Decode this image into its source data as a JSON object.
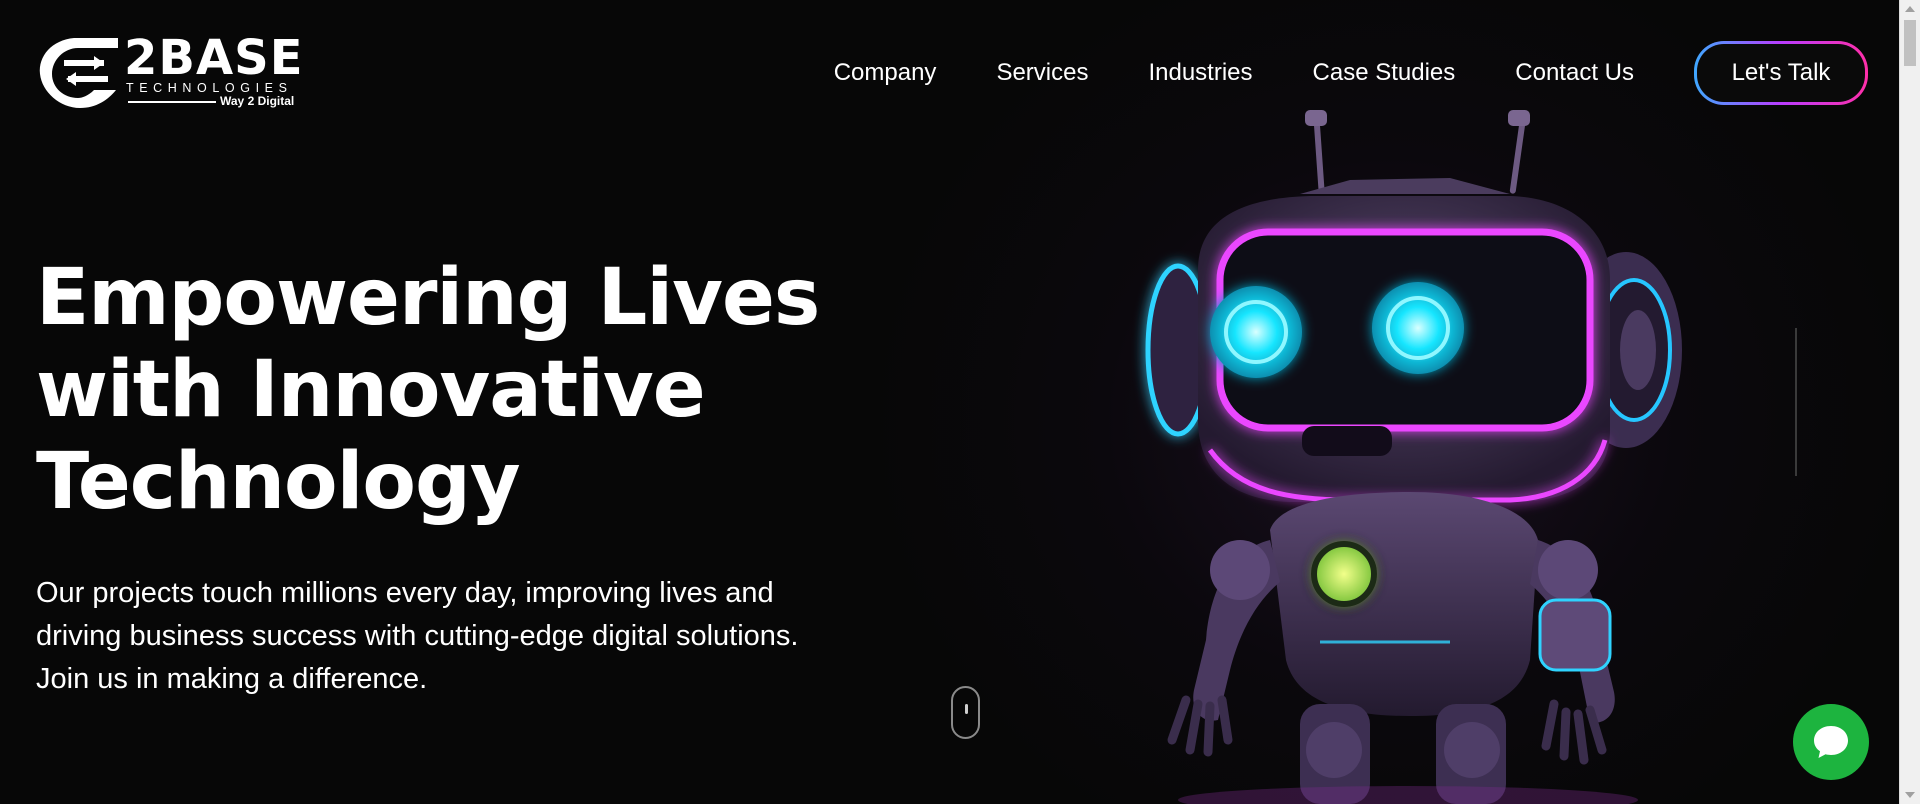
{
  "brand": {
    "name": "2BASE",
    "subtitle": "TECHNOLOGIES",
    "tagline": "Way 2 Digital"
  },
  "nav": {
    "items": [
      {
        "label": "Company"
      },
      {
        "label": "Services"
      },
      {
        "label": "Industries"
      },
      {
        "label": "Case Studies"
      },
      {
        "label": "Contact Us"
      }
    ],
    "cta_label": "Let's Talk"
  },
  "hero": {
    "title_lines": [
      "Empowering Lives",
      "with Innovative",
      "Technology"
    ],
    "description_lines": [
      "Our projects touch millions every day, improving lives and",
      "driving business success with cutting-edge digital solutions.",
      "Join us in making a difference."
    ]
  },
  "icons": {
    "chat": "chat-bubble-icon",
    "scroll": "mouse-scroll-icon",
    "logo": "arrows-logo-icon"
  },
  "colors": {
    "background": "#070707",
    "cta_gradient_start": "#3fa8ff",
    "cta_gradient_end": "#ff2fa9",
    "chat_button": "#1db43f",
    "robot_eyes": "#19e6ff",
    "robot_glow": "#e23bff"
  }
}
